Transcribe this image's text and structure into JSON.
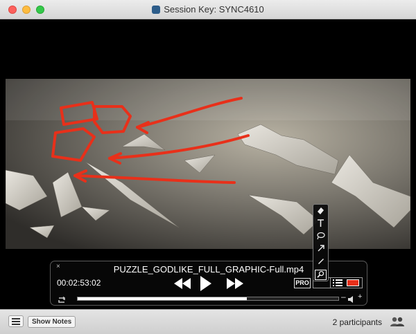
{
  "window": {
    "title": "Session Key: SYNC4610"
  },
  "player": {
    "close_glyph": "×",
    "filename": "PUZZLE_GODLIKE_FULL_GRAPHIC-Full.mp4",
    "timecode": "00:02:53:02",
    "pro_label": "PRO",
    "progress": 0.65,
    "volume_minus": "–",
    "volume_plus": "+",
    "annotation_color": "#e8301a"
  },
  "toolbar": {
    "tools": [
      "eraser-icon",
      "text-icon",
      "lasso-icon",
      "arrow-icon",
      "pen-icon",
      "zoom-icon"
    ],
    "active_tool": "zoom-icon"
  },
  "bottombar": {
    "show_notes_label": "Show Notes",
    "participants_label": "2 participants"
  }
}
